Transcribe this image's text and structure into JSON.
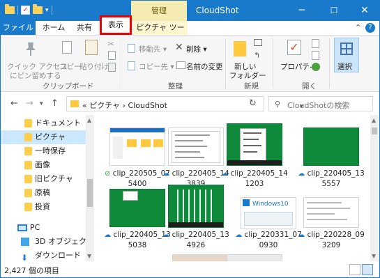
{
  "titlebar": {
    "context_tab": "管理",
    "title": "CloudShot",
    "minimize": "─",
    "maximize": "☐",
    "close": "✕"
  },
  "ribbon_tabs": [
    "ファイル",
    "ホーム",
    "共有",
    "表示",
    "ピクチャ ツール"
  ],
  "ribbon": {
    "clipboard": {
      "pin_label_1": "クイック アクセス",
      "pin_label_2": "にピン留めする",
      "copy": "コピー",
      "paste": "貼り付け",
      "group": "クリップボード"
    },
    "organize": {
      "move_to": "移動先 ▾",
      "copy_to": "コピー先 ▾",
      "delete": "削除 ▾",
      "rename": "名前の変更",
      "group": "整理"
    },
    "new": {
      "new_folder_1": "新しい",
      "new_folder_2": "フォルダー",
      "group": "新規"
    },
    "open": {
      "properties": "プロパティ",
      "group": "開く"
    },
    "select": {
      "label": "選択"
    }
  },
  "address": {
    "prefix": "«",
    "path_1": "ピクチャ",
    "path_sep": "›",
    "path_2": "CloudShot",
    "search_placeholder": "CloudShotの検索"
  },
  "navpane": [
    {
      "label": "ドキュメント",
      "type": "folder"
    },
    {
      "label": "ピクチャ",
      "type": "folder",
      "selected": true
    },
    {
      "label": "一時保存",
      "type": "folder"
    },
    {
      "label": "画像",
      "type": "folder"
    },
    {
      "label": "旧ピクチャ",
      "type": "folder"
    },
    {
      "label": "原稿",
      "type": "folder"
    },
    {
      "label": "投資",
      "type": "folder"
    },
    {
      "label": "PC",
      "type": "pc"
    },
    {
      "label": "3D オブジェクト",
      "type": "3d"
    },
    {
      "label": "ダウンロード",
      "type": "download"
    }
  ],
  "files": [
    {
      "name": "clip_220505_075400",
      "status": "synced-check"
    },
    {
      "name": "clip_220405_143839",
      "status": "cloud"
    },
    {
      "name": "clip_220405_141203",
      "status": "cloud"
    },
    {
      "name": "clip_220405_135557",
      "status": "cloud"
    },
    {
      "name": "clip_220405_135038",
      "status": "cloud"
    },
    {
      "name": "clip_220405_134926",
      "status": "cloud"
    },
    {
      "name": "clip_220331_070930",
      "status": "cloud"
    },
    {
      "name": "clip_220228_093209",
      "status": "cloud"
    }
  ],
  "thumb_texts": {
    "win10": "Windows10"
  },
  "status": {
    "count": "2,427 個の項目"
  },
  "colors": {
    "titlebar": "#1979ca",
    "highlight_border": "#e00000",
    "green_thumb": "#0f8a3a"
  }
}
